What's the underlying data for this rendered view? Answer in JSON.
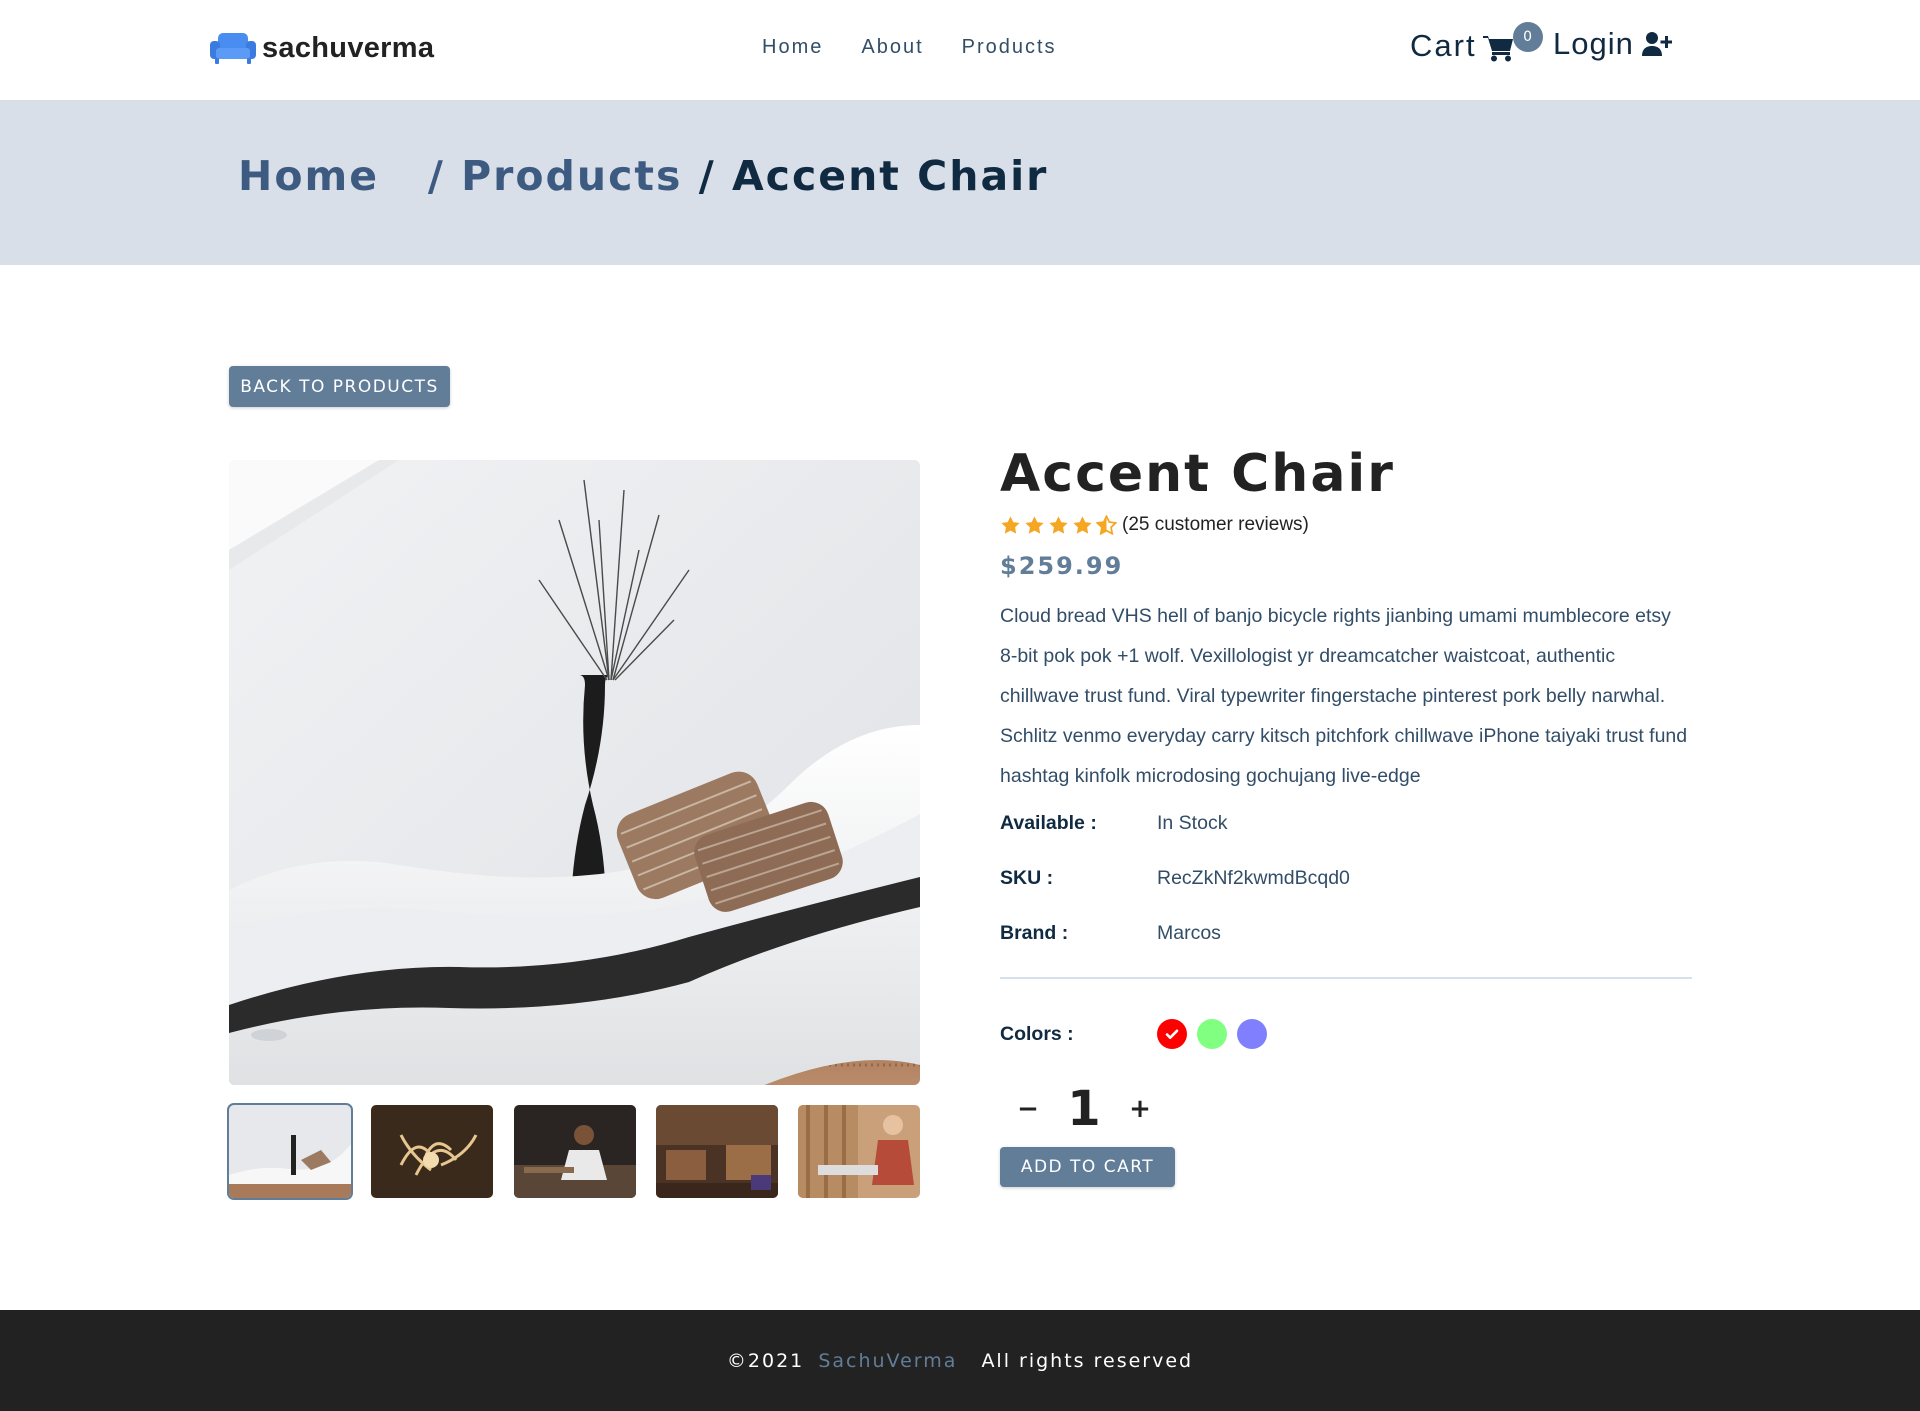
{
  "nav": {
    "logo_text": "sachuverma",
    "links": [
      {
        "label": "Home"
      },
      {
        "label": "About"
      },
      {
        "label": "Products"
      }
    ],
    "cart_label": "Cart",
    "cart_count": "0",
    "login_label": "Login"
  },
  "breadcrumb": {
    "home": "Home",
    "sep1": "/",
    "products": "Products",
    "sep2": "/",
    "current": "Accent Chair"
  },
  "back_button": "BACK TO PRODUCTS",
  "product": {
    "name": "Accent Chair",
    "rating": 4.5,
    "reviews_text": "(25 customer reviews)",
    "price": "$259.99",
    "description": "Cloud bread VHS hell of banjo bicycle rights jianbing umami mumblecore etsy 8-bit pok pok +1 wolf. Vexillologist yr dreamcatcher waistcoat, authentic chillwave trust fund. Viral typewriter fingerstache pinterest pork belly narwhal. Schlitz venmo everyday carry kitsch pitchfork chillwave iPhone taiyaki trust fund hashtag kinfolk microdosing gochujang live-edge",
    "meta": [
      {
        "key": "Available :",
        "value": "In Stock"
      },
      {
        "key": "SKU :",
        "value": "RecZkNf2kwmdBcqd0"
      },
      {
        "key": "Brand :",
        "value": "Marcos"
      }
    ],
    "colors_label": "Colors :",
    "colors": [
      {
        "hex": "#ff0000",
        "selected": true
      },
      {
        "hex": "#80ff80",
        "selected": false
      },
      {
        "hex": "#8080ff",
        "selected": false
      }
    ],
    "amount": "1",
    "decrease_label": "−",
    "increase_label": "+",
    "add_to_cart": "ADD TO CART",
    "thumbnails": [
      "white-lounge-chair",
      "wood-shavings",
      "woodworker-at-bench",
      "furniture-workshop",
      "craftsman-with-wood"
    ]
  },
  "footer": {
    "copyright": "©2021",
    "brand": "SachuVerma",
    "rights": "All rights reserved"
  },
  "colors": {
    "accent": "#617d98",
    "dark": "#102a42",
    "hero_bg": "#d9dfe9",
    "footer_bg": "#222222",
    "star": "#f5a623"
  }
}
